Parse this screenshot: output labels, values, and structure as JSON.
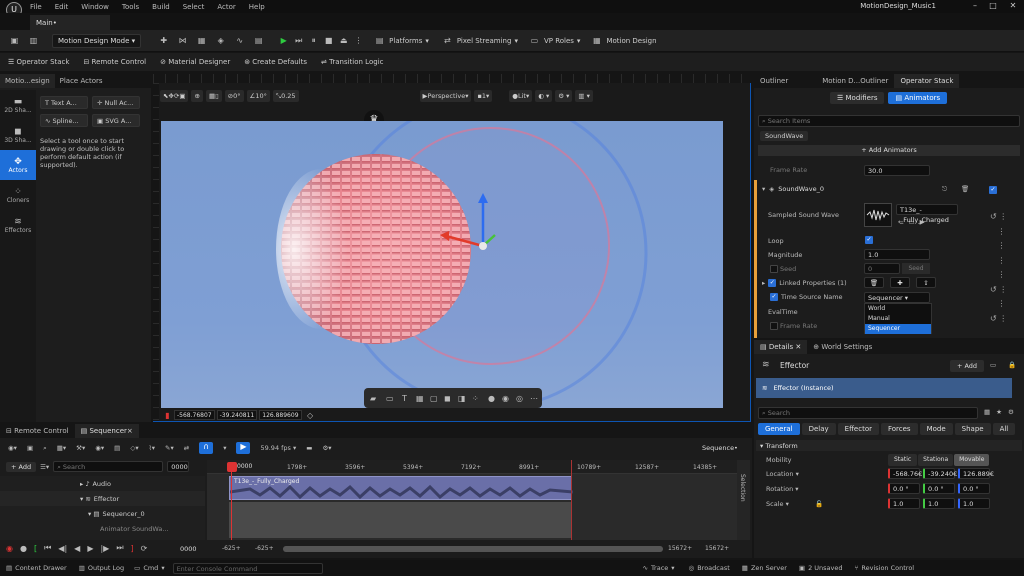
{
  "menu": [
    "File",
    "Edit",
    "Window",
    "Tools",
    "Build",
    "Select",
    "Actor",
    "Help"
  ],
  "main_tab": "Main•",
  "project_name": "MotionDesign_Music1",
  "toolbar": {
    "mode": "Motion Design Mode",
    "platforms": "Platforms",
    "pixel_streaming": "Pixel Streaming",
    "vp_roles": "VP Roles",
    "motion_design": "Motion Design"
  },
  "toolbar2": [
    "Operator Stack",
    "Remote Control",
    "Material Designer",
    "Create Defaults",
    "Transition Logic"
  ],
  "left_tabs": [
    "Motio...esign",
    "Place Actors"
  ],
  "rail": [
    {
      "label": "2D Sha...",
      "icon": "square-icon"
    },
    {
      "label": "3D Sha...",
      "icon": "cube-icon"
    },
    {
      "label": "Actors",
      "icon": "move-icon",
      "active": true
    },
    {
      "label": "Cloners",
      "icon": "dots-icon"
    },
    {
      "label": "Effectors",
      "icon": "effector-icon"
    }
  ],
  "tools": [
    "Text A...",
    "Null Ac...",
    "Spline...",
    "SVG A..."
  ],
  "tool_hint": "Select a tool once to start drawing or double click to perform default action (if supported).",
  "viewport": {
    "values": [
      "0°",
      "10°",
      "0.25"
    ],
    "perspective": "Perspective",
    "lit": "Lit",
    "camera_speed": "1",
    "coords": [
      "-568.76807",
      "-39.240811",
      "126.889609"
    ]
  },
  "right_tabs": [
    "Outliner",
    "Motion D...Outliner",
    "Operator Stack"
  ],
  "modifiers_label": "Modifiers",
  "animators_label": "Animators",
  "search_items": "Search Items",
  "soundwave_chip": "SoundWave",
  "add_animators": "+ Add Animators",
  "frame_rate_label": "Frame Rate",
  "frame_rate_value": "30.0",
  "soundwave_name": "SoundWave_0",
  "props": {
    "sampled_sound_wave": "Sampled Sound Wave",
    "sound_asset": "T13e_-_Fully_Charged",
    "loop": "Loop",
    "magnitude": "Magnitude",
    "magnitude_value": "1.0",
    "seed": "Seed",
    "seed_value": "0",
    "seed_btn": "Seed",
    "linked": "Linked Properties (1)",
    "time_source": "Time Source Name",
    "time_source_value": "Sequencer",
    "eval_time": "EvalTime",
    "frame_rate": "Frame Rate",
    "options": [
      "World",
      "Manual",
      "Sequencer"
    ]
  },
  "details": {
    "tab": "Details",
    "world_settings": "World Settings",
    "actor_name": "Effector",
    "add": "+ Add",
    "instance": "Effector (Instance)",
    "search": "Search",
    "filters": [
      "General",
      "Delay",
      "Effector",
      "Forces",
      "Mode",
      "Shape",
      "All"
    ],
    "transform": "Transform",
    "mobility": "Mobility",
    "mobility_opts": [
      "Static",
      "Stationa",
      "Movable"
    ],
    "location": "Location",
    "rotation": "Rotation",
    "scale": "Scale",
    "loc_vals": [
      "-568.76€",
      "-39.240€",
      "126.889€"
    ],
    "rot_vals": [
      "0.0 °",
      "0.0 °",
      "0.0 °"
    ],
    "scale_vals": [
      "1.0",
      "1.0",
      "1.0"
    ]
  },
  "bottom": {
    "tabs": [
      "Remote Control",
      "Sequencer×"
    ],
    "fps": "59.94 fps",
    "sequence": "Sequence•",
    "add": "+ Add",
    "search": "Search",
    "current_frame": "0000",
    "ticks": [
      "1798+",
      "3596+",
      "5394+",
      "7192+",
      "8991+",
      "10789+",
      "12587+",
      "14385+"
    ],
    "tracks": [
      "Audio",
      "Effector",
      "Sequencer_0",
      "Animator SoundWa..."
    ],
    "clip": "T13e_-_Fully_Charged",
    "range_start": "-625+",
    "range_start2": "-625+",
    "range_end": "15672+",
    "range_end2": "15672+",
    "playhead": "0000",
    "selection": "Selection"
  },
  "statusbar": {
    "content_drawer": "Content Drawer",
    "output_log": "Output Log",
    "cmd": "Cmd",
    "console_placeholder": "Enter Console Command",
    "trace": "Trace",
    "broadcast": "Broadcast",
    "zen": "Zen Server",
    "unsaved": "2 Unsaved",
    "revision": "Revision Control"
  }
}
